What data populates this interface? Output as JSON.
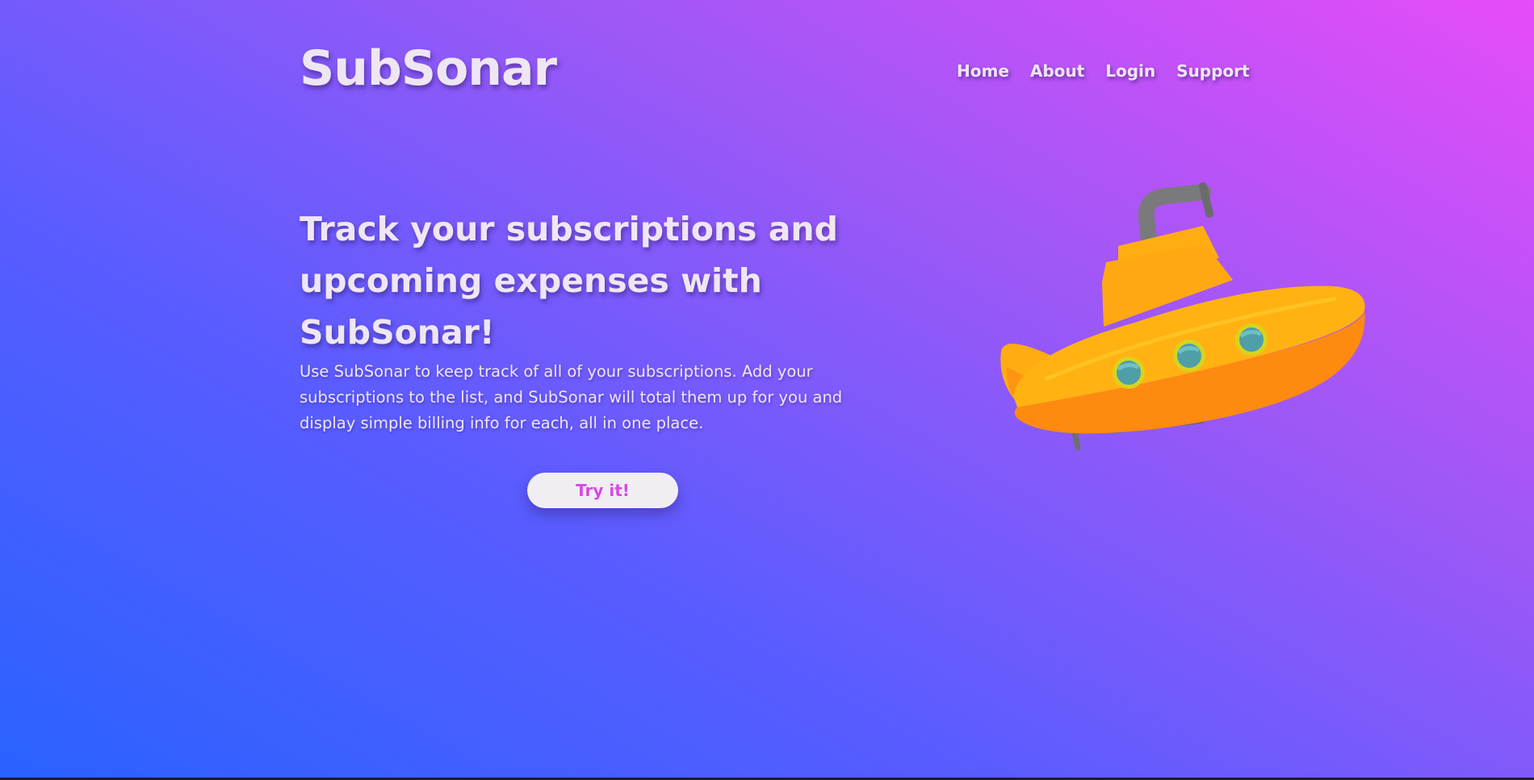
{
  "brand": {
    "name": "SubSonar"
  },
  "nav": {
    "items": [
      {
        "label": "Home"
      },
      {
        "label": "About"
      },
      {
        "label": "Login"
      },
      {
        "label": "Support"
      }
    ]
  },
  "hero": {
    "title": "Track your subscriptions and upcoming expenses with SubSonar!",
    "description": "Use SubSonar to keep track of all of your subscriptions. Add your subscriptions to the list, and SubSonar will total them up for you and display simple billing info for each, all in one place.",
    "cta_label": "Try it!",
    "illustration_icon": "submarine-icon"
  },
  "colors": {
    "gradient_start": "#2962ff",
    "gradient_end": "#e64cf8",
    "cta_text": "#d649e6",
    "cta_background": "#f1eef3",
    "submarine_body": "#ffab12",
    "submarine_hull": "#ff8a10"
  }
}
